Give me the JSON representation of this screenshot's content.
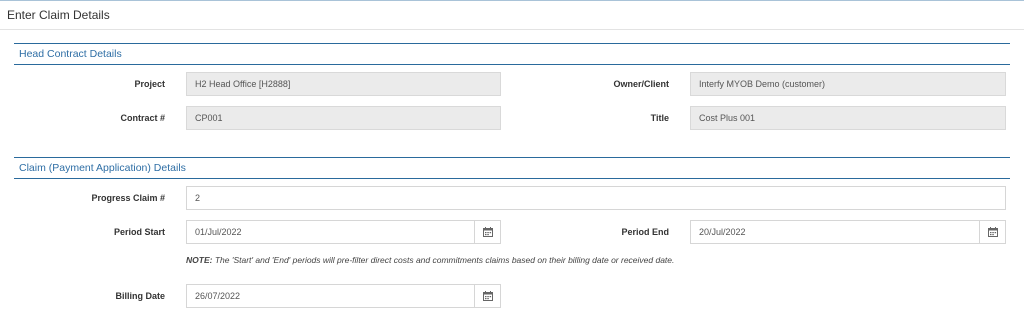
{
  "page": {
    "title": "Enter Claim Details"
  },
  "head_contract": {
    "heading": "Head Contract Details",
    "project_label": "Project",
    "project_value": "H2 Head Office [H2888]",
    "owner_label": "Owner/Client",
    "owner_value": "Interfy MYOB Demo (customer)",
    "contract_label": "Contract #",
    "contract_value": "CP001",
    "title_label": "Title",
    "title_value": "Cost Plus 001"
  },
  "claim": {
    "heading": "Claim (Payment Application) Details",
    "progress_label": "Progress Claim #",
    "progress_value": "2",
    "period_start_label": "Period Start",
    "period_start_value": "01/Jul/2022",
    "period_end_label": "Period End",
    "period_end_value": "20/Jul/2022",
    "note_prefix": "NOTE:",
    "note_text": " The 'Start' and 'End' periods will pre-filter direct costs and commitments claims based on their billing date or received date.",
    "billing_date_label": "Billing Date",
    "billing_date_value": "26/07/2022"
  },
  "icons": {
    "calendar": "calendar-icon"
  },
  "colors": {
    "section_text": "#2e6ea5",
    "section_rule": "#2a6a9c",
    "readonly_bg": "#ebebeb"
  }
}
